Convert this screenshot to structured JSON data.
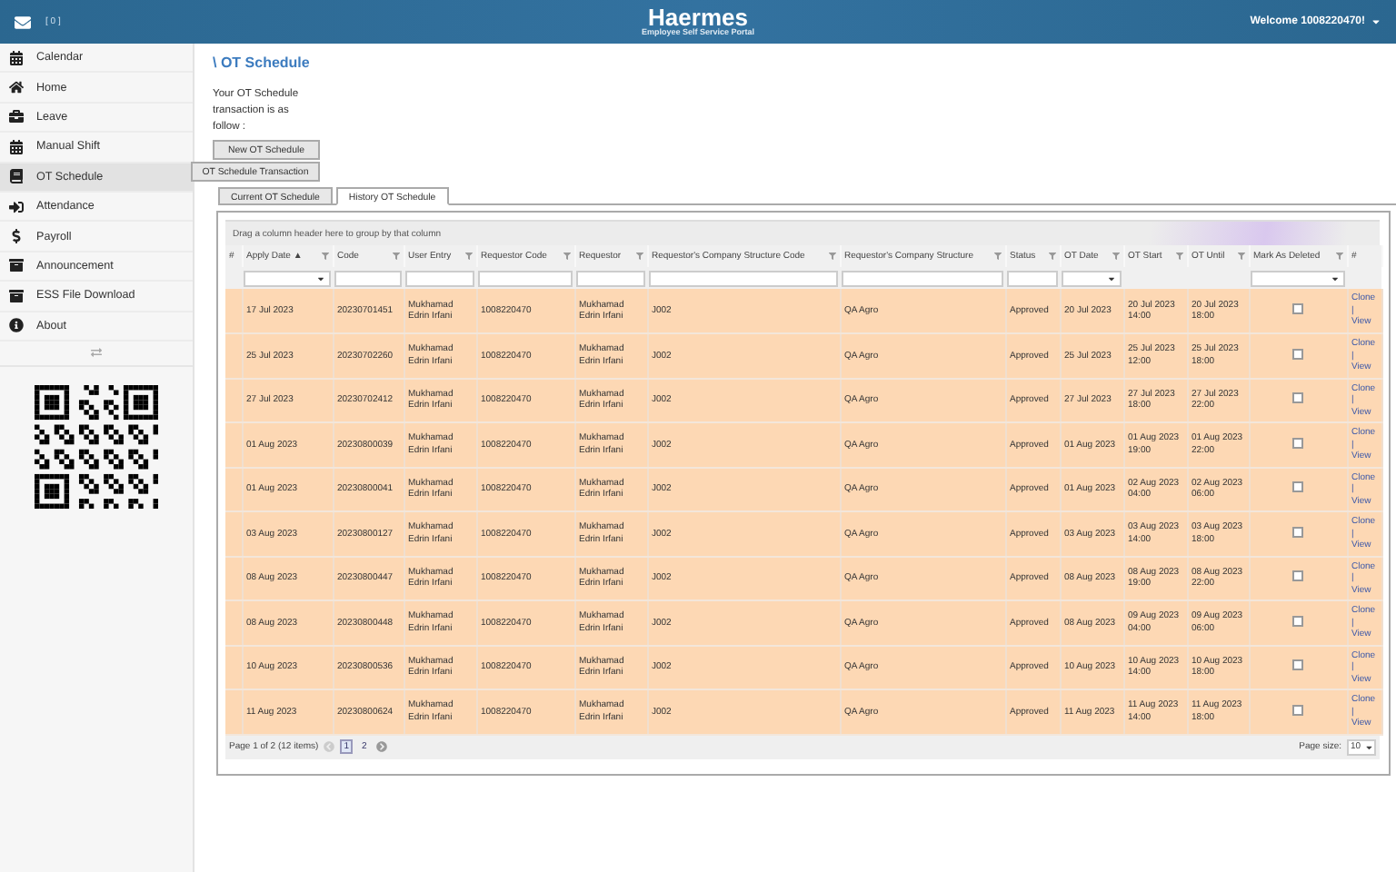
{
  "header": {
    "mail_count": "[ 0 ]",
    "title": "Haermes",
    "subtitle": "Employee Self Service Portal",
    "welcome": "Welcome 1008220470!"
  },
  "sidebar": {
    "items": [
      {
        "label": "Calendar",
        "selected": false
      },
      {
        "label": "Home",
        "selected": false
      },
      {
        "label": "Leave",
        "selected": false
      },
      {
        "label": "Manual Shift",
        "selected": false
      },
      {
        "label": "OT Schedule",
        "selected": true
      },
      {
        "label": "Attendance",
        "selected": false
      },
      {
        "label": "Payroll",
        "selected": false
      },
      {
        "label": "Announcement",
        "selected": false
      },
      {
        "label": "ESS File Download",
        "selected": false
      },
      {
        "label": "About",
        "selected": false
      }
    ]
  },
  "main": {
    "title": "\\ OT Schedule",
    "intro": "Your OT Schedule transaction is as follow :",
    "buttons": [
      "New OT Schedule",
      "OT Schedule Transaction"
    ],
    "tabs": [
      {
        "label": "Current OT Schedule",
        "selected": false
      },
      {
        "label": "History OT Schedule",
        "selected": true
      }
    ],
    "grid": {
      "group_hint": "Drag a column header here to group by that column",
      "columns": [
        {
          "label": "#",
          "kind": "plain"
        },
        {
          "label": "Apply Date",
          "kind": "dropdown",
          "sort_mark": "▲"
        },
        {
          "label": "Code",
          "kind": "text"
        },
        {
          "label": "User Entry",
          "kind": "text"
        },
        {
          "label": "Requestor Code",
          "kind": "text"
        },
        {
          "label": "Requestor",
          "kind": "text"
        },
        {
          "label": "Requestor's Company Structure Code",
          "kind": "text"
        },
        {
          "label": "Requestor's Company Structure",
          "kind": "text"
        },
        {
          "label": "Status",
          "kind": "text"
        },
        {
          "label": "OT Date",
          "kind": "dropdown"
        },
        {
          "label": "OT Start",
          "kind": "icon"
        },
        {
          "label": "OT Until",
          "kind": "icon"
        },
        {
          "label": "Mark As Deleted",
          "kind": "dropdown"
        },
        {
          "label": "#",
          "kind": "plain"
        }
      ],
      "rows": [
        {
          "apply_date": "17 Jul 2023",
          "code": "20230701451",
          "user_entry": "Mukhamad Edrin Irfani",
          "requestor_code": "1008220470",
          "requestor": "Mukhamad Edrin Irfani",
          "structure_code": "J002",
          "structure": "QA Agro",
          "status": "Approved",
          "ot_date": "20 Jul 2023",
          "ot_start": "20 Jul 2023 14:00",
          "ot_until": "20 Jul 2023 18:00",
          "deleted": false,
          "actions": [
            "Clone",
            "|",
            "View"
          ]
        },
        {
          "apply_date": "25 Jul 2023",
          "code": "20230702260",
          "user_entry": "Mukhamad Edrin Irfani",
          "requestor_code": "1008220470",
          "requestor": "Mukhamad Edrin Irfani",
          "structure_code": "J002",
          "structure": "QA Agro",
          "status": "Approved",
          "ot_date": "25 Jul 2023",
          "ot_start": "25 Jul 2023 12:00",
          "ot_until": "25 Jul 2023 18:00",
          "deleted": false,
          "actions": [
            "Clone",
            "|",
            "View"
          ]
        },
        {
          "apply_date": "27 Jul 2023",
          "code": "20230702412",
          "user_entry": "Mukhamad Edrin Irfani",
          "requestor_code": "1008220470",
          "requestor": "Mukhamad Edrin Irfani",
          "structure_code": "J002",
          "structure": "QA Agro",
          "status": "Approved",
          "ot_date": "27 Jul 2023",
          "ot_start": "27 Jul 2023 18:00",
          "ot_until": "27 Jul 2023 22:00",
          "deleted": false,
          "actions": [
            "Clone",
            "|",
            "View"
          ]
        },
        {
          "apply_date": "01 Aug 2023",
          "code": "20230800039",
          "user_entry": "Mukhamad Edrin Irfani",
          "requestor_code": "1008220470",
          "requestor": "Mukhamad Edrin Irfani",
          "structure_code": "J002",
          "structure": "QA Agro",
          "status": "Approved",
          "ot_date": "01 Aug 2023",
          "ot_start": "01 Aug 2023 19:00",
          "ot_until": "01 Aug 2023 22:00",
          "deleted": false,
          "actions": [
            "Clone",
            "|",
            "View"
          ]
        },
        {
          "apply_date": "01 Aug 2023",
          "code": "20230800041",
          "user_entry": "Mukhamad Edrin Irfani",
          "requestor_code": "1008220470",
          "requestor": "Mukhamad Edrin Irfani",
          "structure_code": "J002",
          "structure": "QA Agro",
          "status": "Approved",
          "ot_date": "01 Aug 2023",
          "ot_start": "02 Aug 2023 04:00",
          "ot_until": "02 Aug 2023 06:00",
          "deleted": false,
          "actions": [
            "Clone",
            "|",
            "View"
          ]
        },
        {
          "apply_date": "03 Aug 2023",
          "code": "20230800127",
          "user_entry": "Mukhamad Edrin Irfani",
          "requestor_code": "1008220470",
          "requestor": "Mukhamad Edrin Irfani",
          "structure_code": "J002",
          "structure": "QA Agro",
          "status": "Approved",
          "ot_date": "03 Aug 2023",
          "ot_start": "03 Aug 2023 14:00",
          "ot_until": "03 Aug 2023 18:00",
          "deleted": false,
          "actions": [
            "Clone",
            "|",
            "View"
          ]
        },
        {
          "apply_date": "08 Aug 2023",
          "code": "20230800447",
          "user_entry": "Mukhamad Edrin Irfani",
          "requestor_code": "1008220470",
          "requestor": "Mukhamad Edrin Irfani",
          "structure_code": "J002",
          "structure": "QA Agro",
          "status": "Approved",
          "ot_date": "08 Aug 2023",
          "ot_start": "08 Aug 2023 19:00",
          "ot_until": "08 Aug 2023 22:00",
          "deleted": false,
          "actions": [
            "Clone",
            "|",
            "View"
          ]
        },
        {
          "apply_date": "08 Aug 2023",
          "code": "20230800448",
          "user_entry": "Mukhamad Edrin Irfani",
          "requestor_code": "1008220470",
          "requestor": "Mukhamad Edrin Irfani",
          "structure_code": "J002",
          "structure": "QA Agro",
          "status": "Approved",
          "ot_date": "08 Aug 2023",
          "ot_start": "09 Aug 2023 04:00",
          "ot_until": "09 Aug 2023 06:00",
          "deleted": false,
          "actions": [
            "Clone",
            "|",
            "View"
          ]
        },
        {
          "apply_date": "10 Aug 2023",
          "code": "20230800536",
          "user_entry": "Mukhamad Edrin Irfani",
          "requestor_code": "1008220470",
          "requestor": "Mukhamad Edrin Irfani",
          "structure_code": "J002",
          "structure": "QA Agro",
          "status": "Approved",
          "ot_date": "10 Aug 2023",
          "ot_start": "10 Aug 2023 14:00",
          "ot_until": "10 Aug 2023 18:00",
          "deleted": false,
          "actions": [
            "Clone",
            "|",
            "View"
          ]
        },
        {
          "apply_date": "11 Aug 2023",
          "code": "20230800624",
          "user_entry": "Mukhamad Edrin Irfani",
          "requestor_code": "1008220470",
          "requestor": "Mukhamad Edrin Irfani",
          "structure_code": "J002",
          "structure": "QA Agro",
          "status": "Approved",
          "ot_date": "11 Aug 2023",
          "ot_start": "11 Aug 2023 14:00",
          "ot_until": "11 Aug 2023 18:00",
          "deleted": false,
          "actions": [
            "Clone",
            "|",
            "View"
          ]
        }
      ],
      "pager": {
        "summary": "Page 1 of 2 (12 items)",
        "pages": [
          {
            "label": "1",
            "selected": true
          },
          {
            "label": "2",
            "selected": false
          }
        ],
        "page_size_label": "Page size:",
        "page_size": "10"
      }
    }
  }
}
